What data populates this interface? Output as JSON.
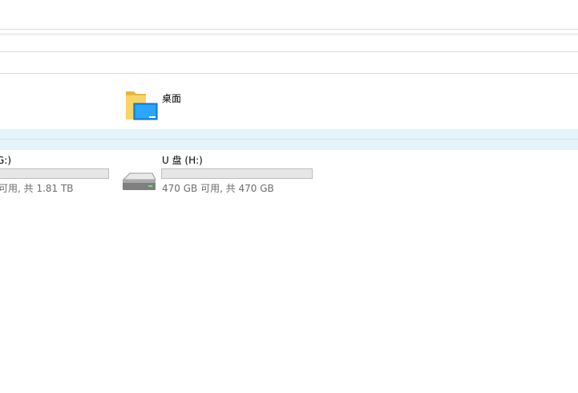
{
  "quick_access": {
    "items": [
      {
        "label": "桌面",
        "icon": "desktop-folder-icon"
      }
    ]
  },
  "drives": [
    {
      "label": "G:)",
      "free_text": "可用, 共 1.81 TB",
      "icon": "hard-drive-icon",
      "used_fraction": 0.0
    },
    {
      "label": "U 盘 (H:)",
      "free_text": "470 GB 可用, 共 470 GB",
      "icon": "hard-drive-icon",
      "used_fraction": 0.0
    }
  ],
  "colors": {
    "section_band": "#e5f3fb",
    "bar_background": "#e6e6e6",
    "bar_fill": "#26a0da",
    "secondary_text": "#6d6d6d"
  }
}
